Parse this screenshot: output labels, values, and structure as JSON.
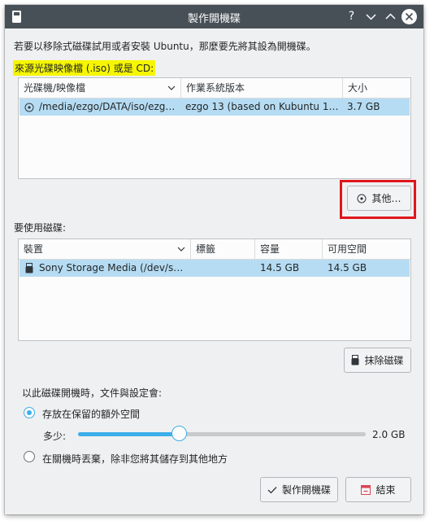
{
  "window": {
    "title": "製作開機碟",
    "help": "?"
  },
  "intro": "若要以移除式磁碟試用或者安裝 Ubuntu，那麼要先將其設為開機碟。",
  "source": {
    "label": "來源光碟映像檔 (.iso) 或是 CD:",
    "columns": [
      "光碟機/映像檔",
      "作業系統版本",
      "大小"
    ],
    "rows": [
      {
        "path": "/media/ezgo/DATA/iso/ezg…",
        "os": "ezgo 13 (based on Kubuntu 1…",
        "size": "3.7 GB"
      }
    ],
    "other_button": "其他…"
  },
  "disk": {
    "label": "要使用磁碟:",
    "columns": [
      "裝置",
      "標籤",
      "容量",
      "可用空間"
    ],
    "rows": [
      {
        "device": "Sony Storage Media (/dev/s…",
        "tag": "",
        "capacity": "14.5 GB",
        "free": "14.5 GB"
      }
    ],
    "erase_button": "抹除磁碟"
  },
  "persistence": {
    "label": "以此磁碟開機時，文件與設定會:",
    "option_keep": "存放在保留的額外空間",
    "amount_label": "多少:",
    "amount_value": "2.0 GB",
    "amount_fraction": 0.35,
    "option_discard": "在關機時丟棄，除非您將其儲存到其他地方",
    "selected": "keep"
  },
  "footer": {
    "make_button": "製作開機碟",
    "quit_button": "結束"
  },
  "colors": {
    "titlebar": "#475057",
    "selection": "#b6dcf3",
    "accent": "#3daee9",
    "highlight": "#f6f600",
    "annotation": "#e0151c"
  }
}
